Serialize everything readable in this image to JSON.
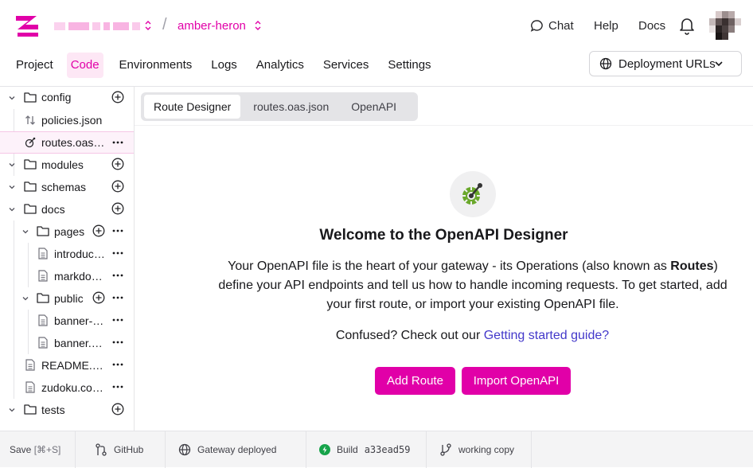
{
  "topbar": {
    "project_name": "amber-heron",
    "chat_label": "Chat",
    "help_label": "Help",
    "docs_label": "Docs"
  },
  "nav": {
    "items": [
      "Project",
      "Code",
      "Environments",
      "Logs",
      "Analytics",
      "Services",
      "Settings"
    ],
    "active": "Code",
    "deployment_urls": "Deployment URLs"
  },
  "sidebar": {
    "items": [
      {
        "label": "config",
        "type": "folder"
      },
      {
        "label": "policies.json",
        "type": "file"
      },
      {
        "label": "routes.oas.json",
        "type": "file",
        "selected": true
      },
      {
        "label": "modules",
        "type": "folder"
      },
      {
        "label": "schemas",
        "type": "folder"
      },
      {
        "label": "docs",
        "type": "folder"
      },
      {
        "label": "pages",
        "type": "folder"
      },
      {
        "label": "introduction.md",
        "type": "file"
      },
      {
        "label": "markdown.md",
        "type": "file"
      },
      {
        "label": "public",
        "type": "folder"
      },
      {
        "label": "banner-dark.svg",
        "type": "file"
      },
      {
        "label": "banner.svg",
        "type": "file"
      },
      {
        "label": "README.md",
        "type": "file"
      },
      {
        "label": "zudoku.config.ts",
        "type": "file"
      },
      {
        "label": "tests",
        "type": "folder"
      }
    ]
  },
  "main": {
    "tabs": [
      "Route Designer",
      "routes.oas.json",
      "OpenAPI"
    ],
    "active_tab": "Route Designer",
    "welcome_title": "Welcome to the OpenAPI Designer",
    "desc_part1": "Your OpenAPI file is the heart of your gateway - its Operations (also known as ",
    "desc_bold": "Routes",
    "desc_part2": ") define your API endpoints and tell us how to handle incoming requests. To get started, add your first route, or import your existing OpenAPI file.",
    "confused_text": "Confused? Check out our ",
    "guide_link": "Getting started guide?",
    "add_route_label": "Add Route",
    "import_label": "Import OpenAPI"
  },
  "statusbar": {
    "save_label": "Save",
    "save_shortcut": "[⌘+S]",
    "github_label": "GitHub",
    "gateway_label": "Gateway deployed",
    "build_label": "Build",
    "build_hash": "a33ead59",
    "branch_label": "working copy"
  },
  "colors": {
    "brand": "#e100a8",
    "link": "#4338ca",
    "build_ok": "#16a34a"
  }
}
